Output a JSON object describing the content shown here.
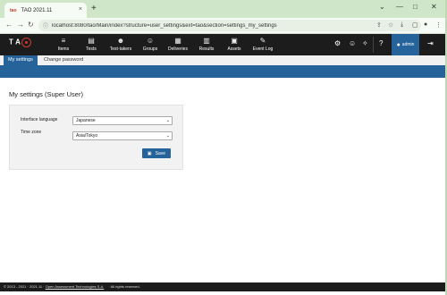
{
  "browser": {
    "tab_favicon_text": "tao",
    "tab_title": "TAO 2021.11",
    "tab_close": "×",
    "new_tab": "+",
    "url": "localhost:8080/tao/Main/index?structure=user_settings&ext=tao&section=settings_my_settings",
    "window_controls": [
      "⌄",
      "—",
      "□",
      "✕"
    ]
  },
  "app": {
    "nav_items": [
      {
        "label": "Items",
        "icon": "list-icon",
        "glyph": "≡"
      },
      {
        "label": "Tests",
        "icon": "tests-icon",
        "glyph": "▤"
      },
      {
        "label": "Test-takers",
        "icon": "test-takers-icon",
        "glyph": "☻"
      },
      {
        "label": "Groups",
        "icon": "groups-icon",
        "glyph": "☺"
      },
      {
        "label": "Deliveries",
        "icon": "deliveries-icon",
        "glyph": "▦"
      },
      {
        "label": "Results",
        "icon": "results-icon",
        "glyph": "▥"
      },
      {
        "label": "Assets",
        "icon": "assets-icon",
        "glyph": "▣"
      },
      {
        "label": "Event Log",
        "icon": "event-log-icon",
        "glyph": "✎"
      }
    ],
    "user": "admin",
    "subtabs": [
      "My settings",
      "Change password"
    ]
  },
  "page": {
    "title": "My settings (Super User)",
    "interface_language_label": "Interface language",
    "interface_language_value": "Japanese",
    "time_zone_label": "Time zone",
    "time_zone_value": "Asia/Tokyo",
    "save_label": "Save"
  },
  "footer": {
    "text": "© 2013 - 2021 · 2021.11 ·",
    "link": "Open Assessment Technologies S.A.",
    "rights": "· All rights reserved."
  },
  "colors": {
    "accent": "#26639a",
    "header": "#1c1c1c",
    "logo_red": "#d23a2f"
  }
}
